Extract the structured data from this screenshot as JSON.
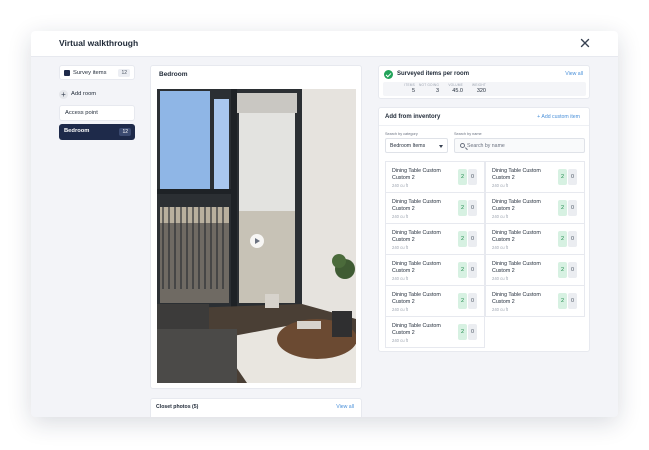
{
  "modal": {
    "title": "Virtual walkthrough"
  },
  "sidebar": {
    "survey_items": {
      "label": "Survey items",
      "count": "12"
    },
    "add_room": "Add room",
    "rooms": [
      {
        "label": "Access point"
      },
      {
        "label": "Bedroom",
        "count": "12",
        "active": true
      }
    ]
  },
  "room_panel": {
    "title": "Bedroom"
  },
  "closet": {
    "title": "Closet photos (5)",
    "link": "View all"
  },
  "surveyed": {
    "title": "Surveyed items per room",
    "link": "View all",
    "stats": [
      {
        "label": "ITEMS",
        "value": "5"
      },
      {
        "label": "NOT GOING",
        "value": "3"
      },
      {
        "label": "VOLUME",
        "value": "45.0"
      },
      {
        "label": "WEIGHT",
        "value": "320"
      }
    ]
  },
  "inventory": {
    "title": "Add from inventory",
    "add_custom": "+ Add custom item",
    "category_label": "Search by category",
    "category_value": "Bedroom Items",
    "name_label": "Search by name",
    "search_placeholder": "Search by name",
    "items": [
      {
        "name": "Dining Table Custom Custom 2",
        "size": "240 cu ft",
        "qty_a": "2",
        "qty_b": "0"
      },
      {
        "name": "Dining Table Custom Custom 2",
        "size": "240 cu ft",
        "qty_a": "2",
        "qty_b": "0"
      },
      {
        "name": "Dining Table Custom Custom 2",
        "size": "240 cu ft",
        "qty_a": "2",
        "qty_b": "0"
      },
      {
        "name": "Dining Table Custom Custom 2",
        "size": "240 cu ft",
        "qty_a": "2",
        "qty_b": "0"
      },
      {
        "name": "Dining Table Custom Custom 2",
        "size": "240 cu ft",
        "qty_a": "2",
        "qty_b": "0"
      },
      {
        "name": "Dining Table Custom Custom 2",
        "size": "240 cu ft",
        "qty_a": "2",
        "qty_b": "0"
      },
      {
        "name": "Dining Table Custom Custom 2",
        "size": "240 cu ft",
        "qty_a": "2",
        "qty_b": "0"
      },
      {
        "name": "Dining Table Custom Custom 2",
        "size": "240 cu ft",
        "qty_a": "2",
        "qty_b": "0"
      },
      {
        "name": "Dining Table Custom Custom 2",
        "size": "240 cu ft",
        "qty_a": "2",
        "qty_b": "0"
      },
      {
        "name": "Dining Table Custom Custom 2",
        "size": "240 cu ft",
        "qty_a": "2",
        "qty_b": "0"
      },
      {
        "name": "Dining Table Custom Custom 2",
        "size": "240 cu ft",
        "qty_a": "2",
        "qty_b": "0"
      }
    ]
  },
  "icons": {
    "close": "close-icon",
    "check": "check-circle-icon",
    "play": "play-icon",
    "search": "search-icon",
    "plus": "plus-icon"
  },
  "colors": {
    "primary_dark": "#1e2a4a",
    "link": "#4a90d9",
    "success": "#22a35a"
  }
}
